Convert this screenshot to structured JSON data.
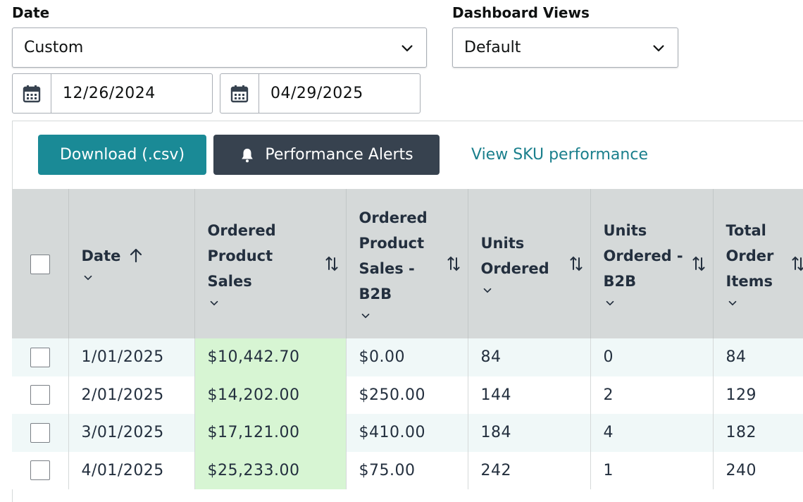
{
  "filters": {
    "date_label": "Date",
    "date_select": "Custom",
    "views_label": "Dashboard Views",
    "views_select": "Default",
    "start_date": "12/26/2024",
    "end_date": "04/29/2025"
  },
  "toolbar": {
    "download_label": "Download (.csv)",
    "alerts_label": "Performance Alerts",
    "sku_link": "View SKU performance"
  },
  "table": {
    "headers": {
      "date": "Date",
      "ordered_sales": "Ordered Product Sales",
      "ordered_sales_b2b": "Ordered Product Sales - B2B",
      "units": "Units Ordered",
      "units_b2b": "Units Ordered - B2B",
      "order_items": "Total Order Items"
    },
    "rows": [
      {
        "date": "1/01/2025",
        "sales": "$10,442.70",
        "sales_b2b": "$0.00",
        "units": "84",
        "units_b2b": "0",
        "items": "84"
      },
      {
        "date": "2/01/2025",
        "sales": "$14,202.00",
        "sales_b2b": "$250.00",
        "units": "144",
        "units_b2b": "2",
        "items": "129"
      },
      {
        "date": "3/01/2025",
        "sales": "$17,121.00",
        "sales_b2b": "$410.00",
        "units": "184",
        "units_b2b": "4",
        "items": "182"
      },
      {
        "date": "4/01/2025",
        "sales": "$25,233.00",
        "sales_b2b": "$75.00",
        "units": "242",
        "units_b2b": "1",
        "items": "240"
      }
    ]
  },
  "colors": {
    "download_button": "#1a8a96",
    "alerts_button": "#37424f",
    "link": "#1a7f8c",
    "header_bg": "#d5d9d9",
    "highlight": "#d7f5d3"
  }
}
